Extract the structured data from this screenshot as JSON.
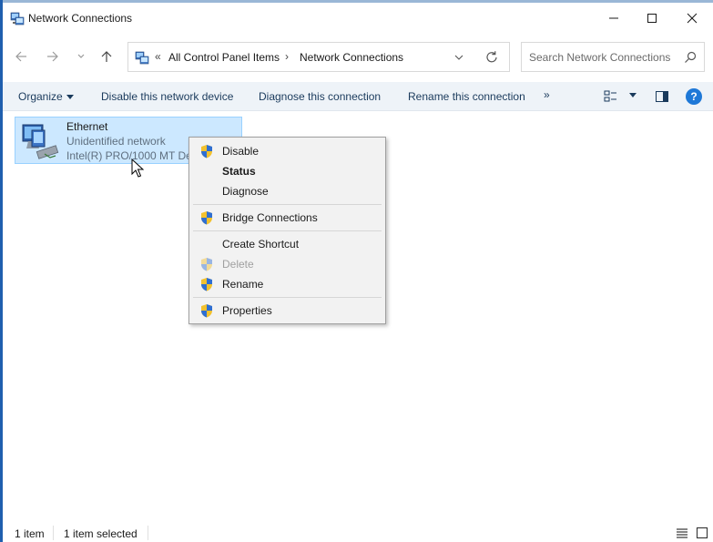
{
  "window": {
    "title": "Network Connections",
    "accent_color": "#1f5fae"
  },
  "address_bar": {
    "overflow_glyph": "«",
    "crumbs": [
      "All Control Panel Items",
      "Network Connections"
    ],
    "separator": "›"
  },
  "search": {
    "placeholder": "Search Network Connections"
  },
  "command_bar": {
    "organize": "Organize",
    "disable": "Disable this network device",
    "diagnose": "Diagnose this connection",
    "rename": "Rename this connection",
    "more": "»",
    "help": "?"
  },
  "item": {
    "name": "Ethernet",
    "status": "Unidentified network",
    "device": "Intel(R) PRO/1000 MT Desktop Adapter",
    "selection_color": "#cce8ff"
  },
  "context_menu": {
    "items": [
      {
        "label": "Disable",
        "icon": "uac-shield-icon",
        "bold": false,
        "disabled": false
      },
      {
        "label": "Status",
        "icon": "",
        "bold": true,
        "disabled": false
      },
      {
        "label": "Diagnose",
        "icon": "",
        "bold": false,
        "disabled": false
      },
      {
        "label": "Bridge Connections",
        "icon": "uac-shield-icon",
        "bold": false,
        "disabled": false
      },
      {
        "label": "Create Shortcut",
        "icon": "",
        "bold": false,
        "disabled": false
      },
      {
        "label": "Delete",
        "icon": "uac-shield-icon",
        "bold": false,
        "disabled": true
      },
      {
        "label": "Rename",
        "icon": "uac-shield-icon",
        "bold": false,
        "disabled": false
      },
      {
        "label": "Properties",
        "icon": "uac-shield-icon",
        "bold": false,
        "disabled": false
      }
    ]
  },
  "status_bar": {
    "count": "1 item",
    "selected": "1 item selected"
  }
}
